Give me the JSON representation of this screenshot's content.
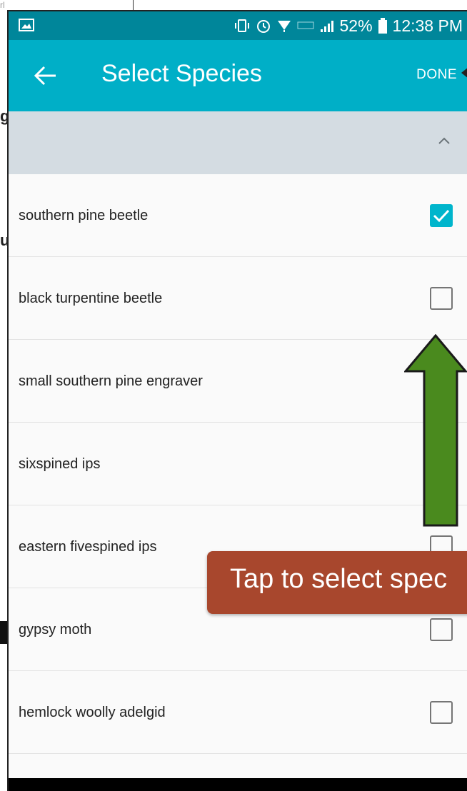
{
  "status_bar": {
    "battery": "52%",
    "time": "12:38 PM"
  },
  "app_bar": {
    "title": "Select Species",
    "done_label": "DONE"
  },
  "species": [
    {
      "name": "southern pine beetle",
      "checked": true
    },
    {
      "name": "black turpentine beetle",
      "checked": false
    },
    {
      "name": "small southern pine engraver",
      "checked": false
    },
    {
      "name": "sixspined ips",
      "checked": false
    },
    {
      "name": "eastern fivespined ips",
      "checked": false
    },
    {
      "name": "gypsy moth",
      "checked": false
    },
    {
      "name": "hemlock woolly adelgid",
      "checked": false
    }
  ],
  "annotation": {
    "callout_text": "Tap to select spec"
  },
  "background_fragments": {
    "frag_1": "rl",
    "frag_2": "g",
    "frag_3": "u"
  },
  "colors": {
    "status_bar": "#00869a",
    "app_bar": "#00afc7",
    "group_header": "#d4dce2",
    "checkbox_checked": "#00b5cc",
    "callout": "#a8472d",
    "arrow": "#4a8a1e"
  }
}
